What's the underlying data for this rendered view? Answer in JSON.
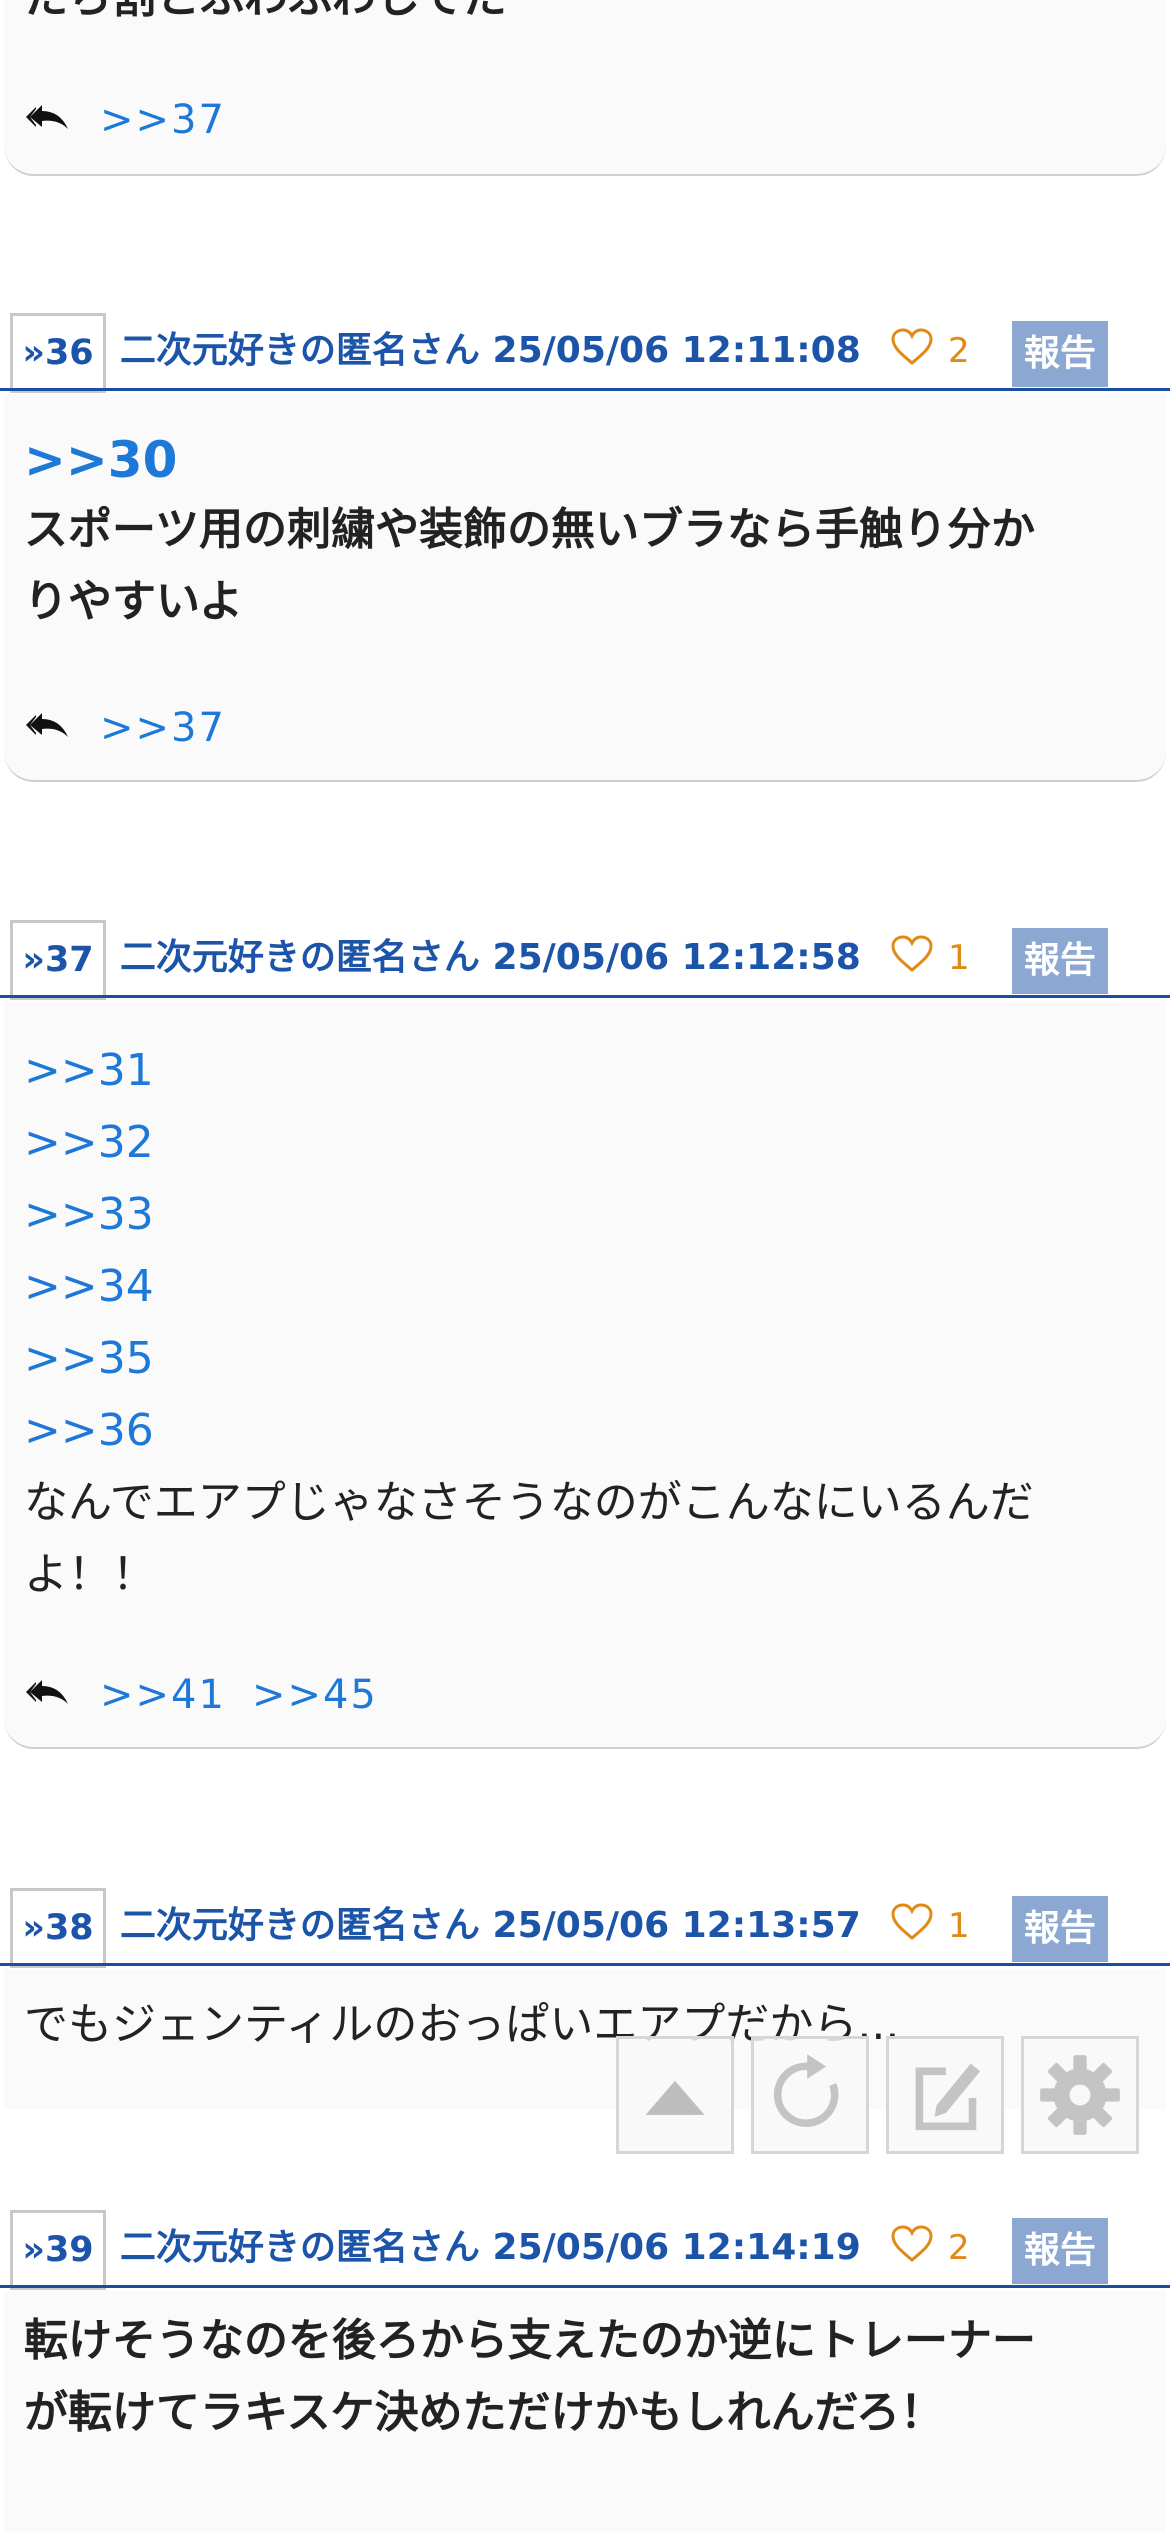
{
  "top_partial": {
    "text": "たら割とふわふわしてた",
    "replies": [
      ">>37"
    ]
  },
  "posts": [
    {
      "number": "36",
      "meta": "二次元好きの匿名さん 25/05/06 12:11:08",
      "likes": "2",
      "report": "報告",
      "anchor": ">>30",
      "lines": [
        "スポーツ用の刺繍や装飾の無いブラなら手触り分か",
        "りやすいよ"
      ],
      "replies": [
        ">>37"
      ]
    },
    {
      "number": "37",
      "meta": "二次元好きの匿名さん 25/05/06 12:12:58",
      "likes": "1",
      "report": "報告",
      "anchors": [
        ">>31",
        ">>32",
        ">>33",
        ">>34",
        ">>35",
        ">>36"
      ],
      "lines": [
        "なんでエアプじゃなさそうなのがこんなにいるんだ",
        "よ！！"
      ],
      "replies": [
        ">>41",
        ">>45"
      ]
    },
    {
      "number": "38",
      "meta": "二次元好きの匿名さん 25/05/06 12:13:57",
      "likes": "1",
      "report": "報告",
      "lines": [
        "でもジェンティルのおっぱいエアプだから..."
      ]
    },
    {
      "number": "39",
      "meta": "二次元好きの匿名さん 25/05/06 12:14:19",
      "likes": "2",
      "report": "報告",
      "lines": [
        "転けそうなのを後ろから支えたのか逆にトレーナー",
        "が転けてラキスケ決めただけかもしれんだろ！"
      ]
    }
  ],
  "fab_buttons": [
    {
      "icon": "triangle-up-icon"
    },
    {
      "icon": "refresh-icon"
    },
    {
      "icon": "edit-icon"
    },
    {
      "icon": "gear-icon"
    }
  ],
  "colors": {
    "accent": "#1b54a8",
    "link": "#1e78d8",
    "like": "#e08a16",
    "report_bg": "#8ba7d2"
  }
}
